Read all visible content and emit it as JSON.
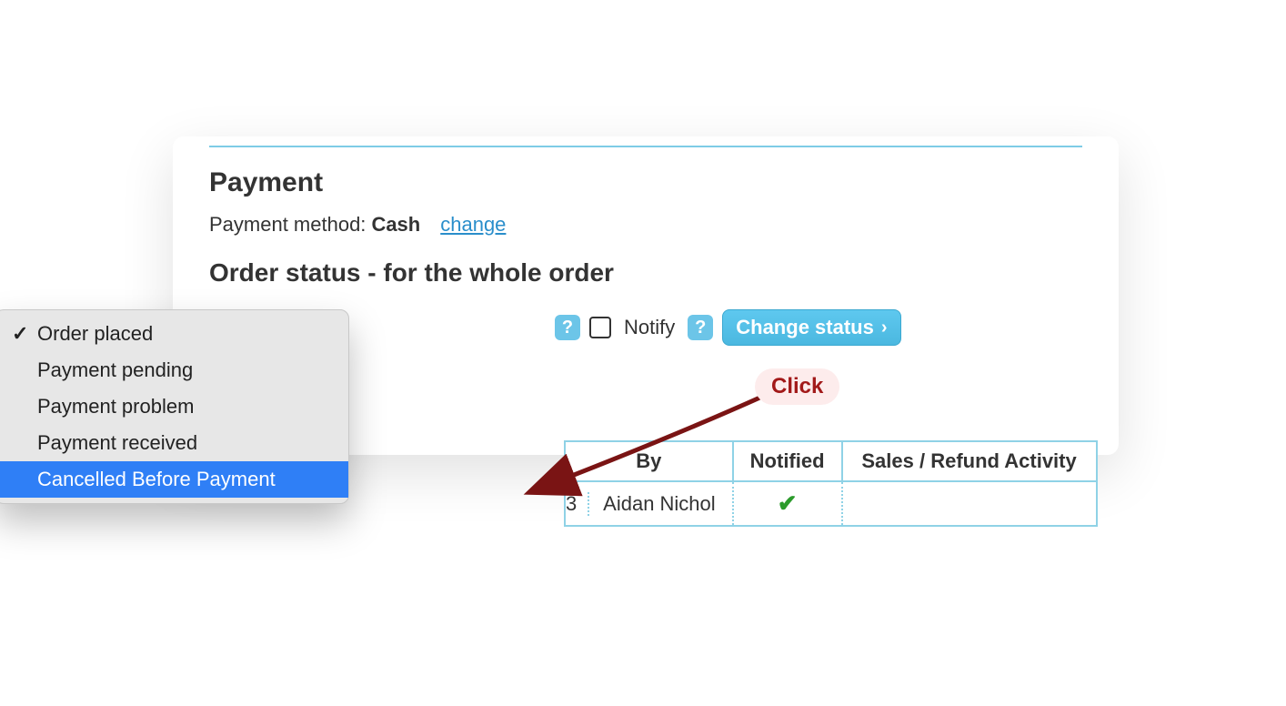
{
  "section_title": "Payment",
  "payment_method_label": "Payment method:",
  "payment_method_value": "Cash",
  "change_link": "change",
  "subtitle": "Order status - for the whole order",
  "notify_label": "Notify",
  "change_status_button": "Change status",
  "click_annotation": "Click",
  "dropdown": {
    "items": [
      {
        "label": "Order placed",
        "checked": true,
        "highlight": false
      },
      {
        "label": "Payment pending",
        "checked": false,
        "highlight": false
      },
      {
        "label": "Payment problem",
        "checked": false,
        "highlight": false
      },
      {
        "label": "Payment received",
        "checked": false,
        "highlight": false
      },
      {
        "label": "Cancelled Before Payment",
        "checked": false,
        "highlight": true
      }
    ]
  },
  "table": {
    "headers": {
      "by": "By",
      "notified": "Notified",
      "activity": "Sales / Refund Activity"
    },
    "row": {
      "partial_cell": "3",
      "by": "Aidan Nichol",
      "notified_checked": true,
      "activity": ""
    }
  }
}
